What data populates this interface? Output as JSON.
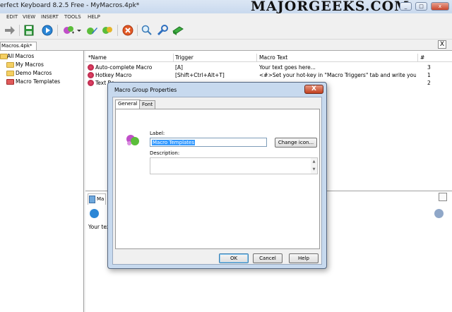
{
  "window": {
    "title": "erfect Keyboard 8.2.5 Free - MyMacros.4pk*",
    "watermark": "MAJORGEEKS.COM",
    "minimize": "_",
    "maximize": "□",
    "close": "x"
  },
  "menu": [
    "EDIT",
    "VIEW",
    "INSERT",
    "TOOLS",
    "HELP"
  ],
  "file_tab": {
    "label": "Macros.4pk*",
    "close": "X"
  },
  "tree": {
    "items": [
      {
        "label": "All Macros"
      },
      {
        "label": "My Macros"
      },
      {
        "label": "Demo Macros"
      },
      {
        "label": "Macro Templates"
      }
    ]
  },
  "list": {
    "headers": {
      "name": "*Name",
      "trigger": "Trigger",
      "macro_text": "Macro Text",
      "num": "#"
    },
    "rows": [
      {
        "name": "Auto-complete Macro",
        "trigger": "[A]",
        "text": "Your text goes here...",
        "num": "3"
      },
      {
        "name": "Hotkey Macro",
        "trigger": "[Shift+Ctrl+Alt+T]",
        "text": "<#>Set your hot-key in \"Macro Triggers\" tab and write your macro text h...",
        "num": "1"
      },
      {
        "name": "Text Re",
        "trigger": "",
        "text": "",
        "num": "2"
      }
    ]
  },
  "bottom": {
    "tab_label": "Ma",
    "text": "Your text"
  },
  "dialog": {
    "title": "Macro Group Properties",
    "close": "X",
    "tabs": [
      "General",
      "Font"
    ],
    "label_caption": "Label:",
    "label_value": "Macro Templates",
    "change_icon": "Change icon...",
    "description_caption": "Description:",
    "ok": "OK",
    "cancel": "Cancel",
    "help": "Help"
  }
}
